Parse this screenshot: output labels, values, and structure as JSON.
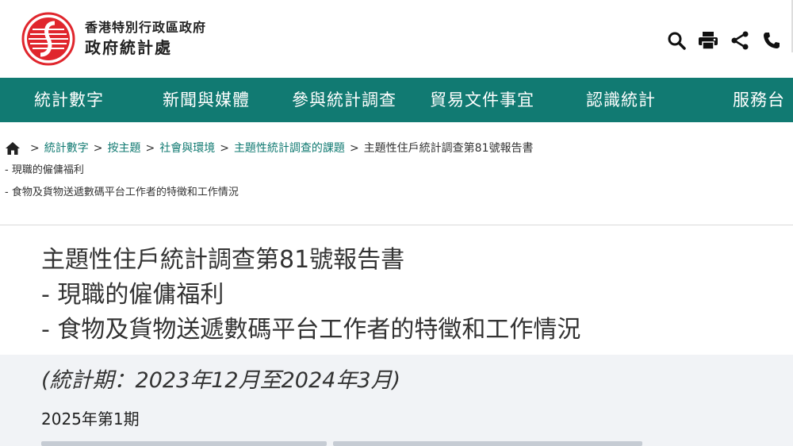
{
  "header": {
    "org_line1": "香港特別行政區政府",
    "org_line2": "政府統計處",
    "tools": [
      "search-icon",
      "print-icon",
      "share-icon",
      "phone-icon"
    ]
  },
  "nav": {
    "items": [
      "統計數字",
      "新聞與媒體",
      "參與統計調查",
      "貿易文件事宜",
      "認識統計",
      "服務台"
    ]
  },
  "breadcrumb": {
    "items": [
      "統計數字",
      "按主題",
      "社會與環境",
      "主題性統計調查的課題"
    ],
    "current": "主題性住戶統計調查第81號報告書",
    "sub1": "- 現職的僱傭福利",
    "sub2": "- 食物及貨物送遞數碼平台工作者的特徵和工作情況"
  },
  "main": {
    "title_line1": "主題性住戶統計調查第81號報告書",
    "title_line2": "- 現職的僱傭福利",
    "title_line3": "- 食物及貨物送遞數碼平台工作者的特徵和工作情況",
    "period": "(統計期：2023年12月至2024年3月)",
    "issue": "2025年第1期"
  },
  "colors": {
    "nav_bg": "#117a72",
    "logo_red": "#e0262d",
    "panel_bg": "#f1f3f6"
  }
}
